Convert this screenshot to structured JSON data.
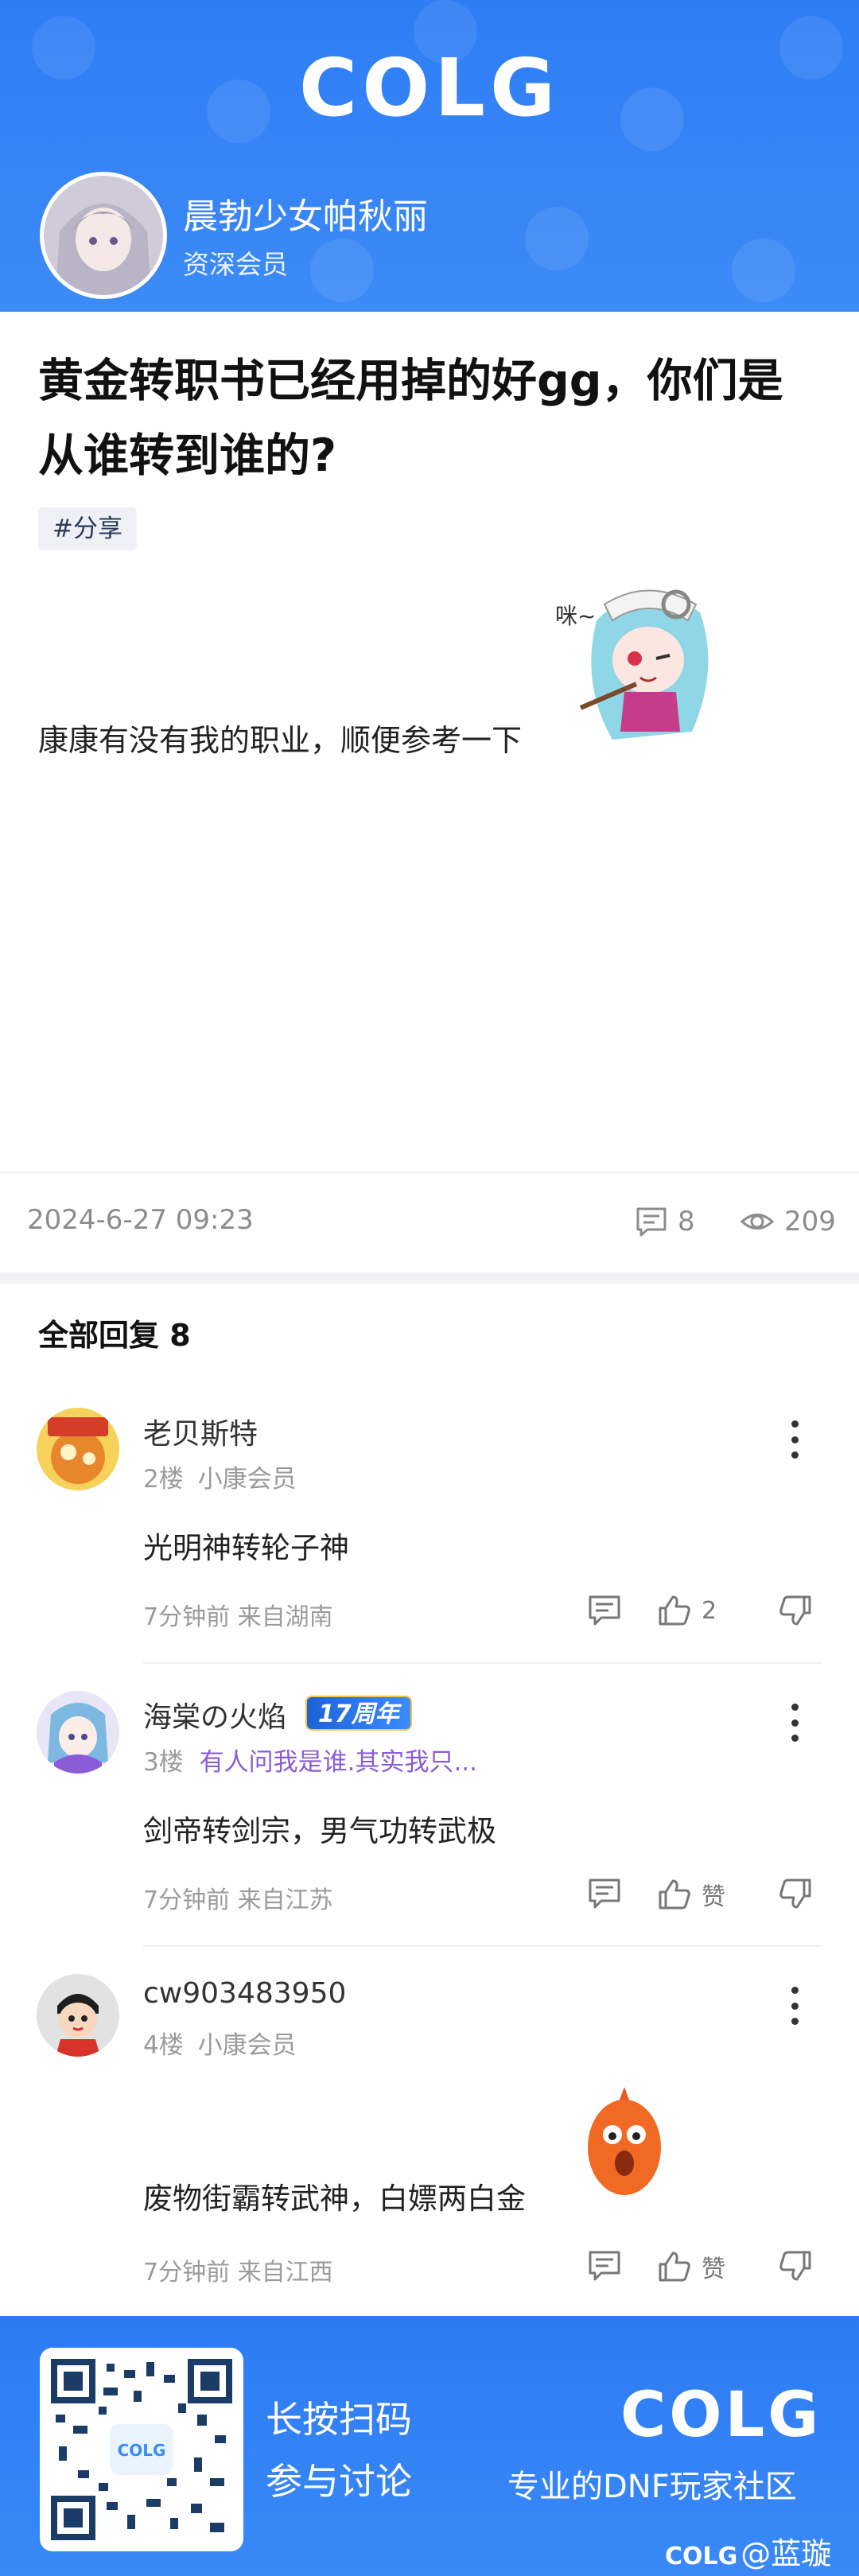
{
  "header": {
    "logo": "COLG",
    "author_name": "晨勃少女帕秋丽",
    "author_role": "资深会员"
  },
  "post": {
    "title_line1": "黄金转职书已经用掉的好gg，你们是",
    "title_line2": "从谁转到谁的?",
    "tag": "#分享",
    "body": "康康有没有我的职业，顺便参考一下",
    "date": "2024-6-27 09:23",
    "comment_count": "8",
    "view_count": "209"
  },
  "replies": {
    "heading": "全部回复  8",
    "items": [
      {
        "name": "老贝斯特",
        "floor": "2楼",
        "member": "小康会员",
        "text": "光明神转轮子神",
        "time": "7分钟前 来自湖南",
        "like": "2"
      },
      {
        "name": "海棠の火焰",
        "badge": "17周年",
        "floor": "3楼",
        "signature": "有人问我是谁.其实我只...",
        "text": "剑帝转剑宗，男气功转武极",
        "time": "7分钟前 来自江苏",
        "like": "赞"
      },
      {
        "name": "cw903483950",
        "floor": "4楼",
        "member": "小康会员",
        "text": "废物街霸转武神，白嫖两白金",
        "time": "7分钟前 来自江西",
        "like": "赞"
      }
    ]
  },
  "footer": {
    "qr_logo": "COLG",
    "line1": "长按扫码",
    "line2": "参与讨论",
    "logo": "COLG",
    "slogan": "专业的DNF玩家社区",
    "watermark_logo": "COLG",
    "watermark_user": "@蓝璇"
  },
  "colors": {
    "brand_blue": "#2f7df5",
    "signature_purple": "#8a5cd8"
  }
}
